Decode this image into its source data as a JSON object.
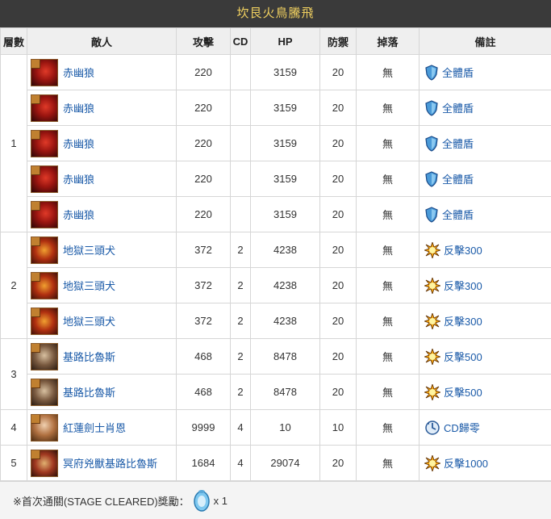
{
  "title": "坎艮火鳥騰飛",
  "headers": [
    "層數",
    "敵人",
    "攻擊",
    "CD",
    "HP",
    "防禦",
    "掉落",
    "備註"
  ],
  "floors": [
    {
      "floor": "1",
      "rows": [
        {
          "enemy": "赤幽狼",
          "portrait": "red",
          "atk": "220",
          "cd": "",
          "hp": "3159",
          "def": "20",
          "drop": "無",
          "note_icon": "shield-icon",
          "note": "全體盾"
        },
        {
          "enemy": "赤幽狼",
          "portrait": "red",
          "atk": "220",
          "cd": "",
          "hp": "3159",
          "def": "20",
          "drop": "無",
          "note_icon": "shield-icon",
          "note": "全體盾"
        },
        {
          "enemy": "赤幽狼",
          "portrait": "red",
          "atk": "220",
          "cd": "",
          "hp": "3159",
          "def": "20",
          "drop": "無",
          "note_icon": "shield-icon",
          "note": "全體盾"
        },
        {
          "enemy": "赤幽狼",
          "portrait": "red",
          "atk": "220",
          "cd": "",
          "hp": "3159",
          "def": "20",
          "drop": "無",
          "note_icon": "shield-icon",
          "note": "全體盾"
        },
        {
          "enemy": "赤幽狼",
          "portrait": "red",
          "atk": "220",
          "cd": "",
          "hp": "3159",
          "def": "20",
          "drop": "無",
          "note_icon": "shield-icon",
          "note": "全體盾"
        }
      ]
    },
    {
      "floor": "2",
      "rows": [
        {
          "enemy": "地獄三頭犬",
          "portrait": "dog",
          "atk": "372",
          "cd": "2",
          "hp": "4238",
          "def": "20",
          "drop": "無",
          "note_icon": "burst-icon",
          "note": "反擊300"
        },
        {
          "enemy": "地獄三頭犬",
          "portrait": "dog",
          "atk": "372",
          "cd": "2",
          "hp": "4238",
          "def": "20",
          "drop": "無",
          "note_icon": "burst-icon",
          "note": "反擊300"
        },
        {
          "enemy": "地獄三頭犬",
          "portrait": "dog",
          "atk": "372",
          "cd": "2",
          "hp": "4238",
          "def": "20",
          "drop": "無",
          "note_icon": "burst-icon",
          "note": "反擊300"
        }
      ]
    },
    {
      "floor": "3",
      "rows": [
        {
          "enemy": "基路比魯斯",
          "portrait": "cer",
          "atk": "468",
          "cd": "2",
          "hp": "8478",
          "def": "20",
          "drop": "無",
          "note_icon": "burst-icon",
          "note": "反擊500"
        },
        {
          "enemy": "基路比魯斯",
          "portrait": "cer",
          "atk": "468",
          "cd": "2",
          "hp": "8478",
          "def": "20",
          "drop": "無",
          "note_icon": "burst-icon",
          "note": "反擊500"
        }
      ]
    },
    {
      "floor": "4",
      "rows": [
        {
          "enemy": "紅蓮劍士肖恩",
          "portrait": "sw",
          "atk": "9999",
          "cd": "4",
          "hp": "10",
          "def": "10",
          "drop": "無",
          "note_icon": "cd-reset-icon",
          "note": "CD歸零"
        }
      ]
    },
    {
      "floor": "5",
      "rows": [
        {
          "enemy": "冥府兇獸基路比魯斯",
          "portrait": "hell",
          "atk": "1684",
          "cd": "4",
          "hp": "29074",
          "def": "20",
          "drop": "無",
          "note_icon": "burst-icon",
          "note": "反擊1000"
        }
      ]
    }
  ],
  "footer": {
    "label": "※首次通關(STAGE CLEARED)獎勵：",
    "reward_icon": "diamond-icon",
    "count": "x 1"
  },
  "colors": {
    "title_bg": "#3a3a3a",
    "title_text": "#f0d060",
    "link": "#1a5aa8",
    "header_bg": "#efefef"
  }
}
